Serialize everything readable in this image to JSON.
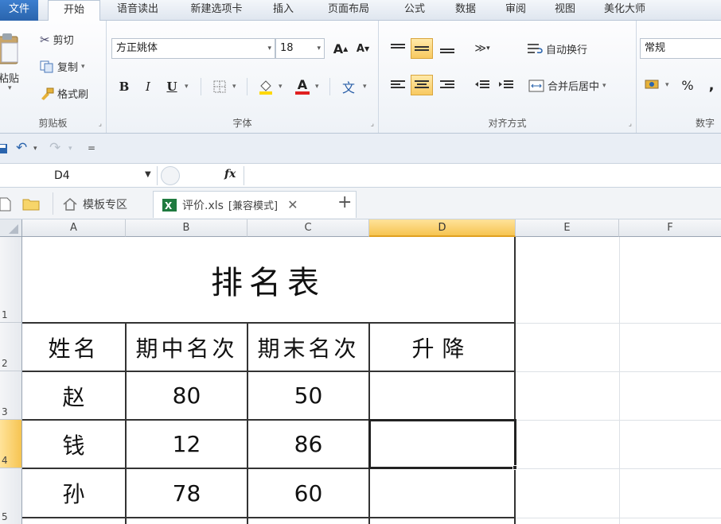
{
  "menu": {
    "tabs": [
      "文件",
      "开始",
      "语音读出",
      "新建选项卡",
      "插入",
      "页面布局",
      "公式",
      "数据",
      "审阅",
      "视图",
      "美化大师"
    ],
    "active": "开始"
  },
  "clipboard": {
    "paste": "粘贴",
    "cut": "剪切",
    "copy": "复制",
    "format_painter": "格式刷",
    "label": "剪贴板"
  },
  "font": {
    "name": "方正姚体",
    "size": "18",
    "grow": "A",
    "shrink": "A",
    "bold": "B",
    "italic": "I",
    "underline": "U",
    "font_color_letter": "A",
    "phonetic": "文",
    "label": "字体"
  },
  "alignment": {
    "wrap_text": "自动换行",
    "merge_center": "合并后居中",
    "label": "对齐方式"
  },
  "number": {
    "format": "常规",
    "percent": "%",
    "comma": ",",
    "label": "数字"
  },
  "formula_bar": {
    "name_box": "D4",
    "fx": "fx",
    "value": ""
  },
  "doc_tabs": {
    "template": "模板专区",
    "file": "评价.xls",
    "mode": "[兼容模式]",
    "close": "✕",
    "add": "+"
  },
  "sheet": {
    "columns": [
      "A",
      "B",
      "C",
      "D",
      "E",
      "F"
    ],
    "selected_column": "D",
    "rows": [
      "1",
      "2",
      "3",
      "4",
      "5"
    ],
    "selected_row": "4",
    "title": "排名表",
    "headers": [
      "姓名",
      "期中名次",
      "期末名次",
      "升降"
    ],
    "data": [
      [
        "赵",
        "80",
        "50",
        ""
      ],
      [
        "钱",
        "12",
        "86",
        ""
      ],
      [
        "孙",
        "78",
        "60",
        ""
      ]
    ]
  },
  "colors": {
    "accent_file": "#2a64ad",
    "selected_header": "#f6c451",
    "selected_button": "#f8c960",
    "font_color_red": "#e02020",
    "fill_yellow": "#ffd800"
  }
}
